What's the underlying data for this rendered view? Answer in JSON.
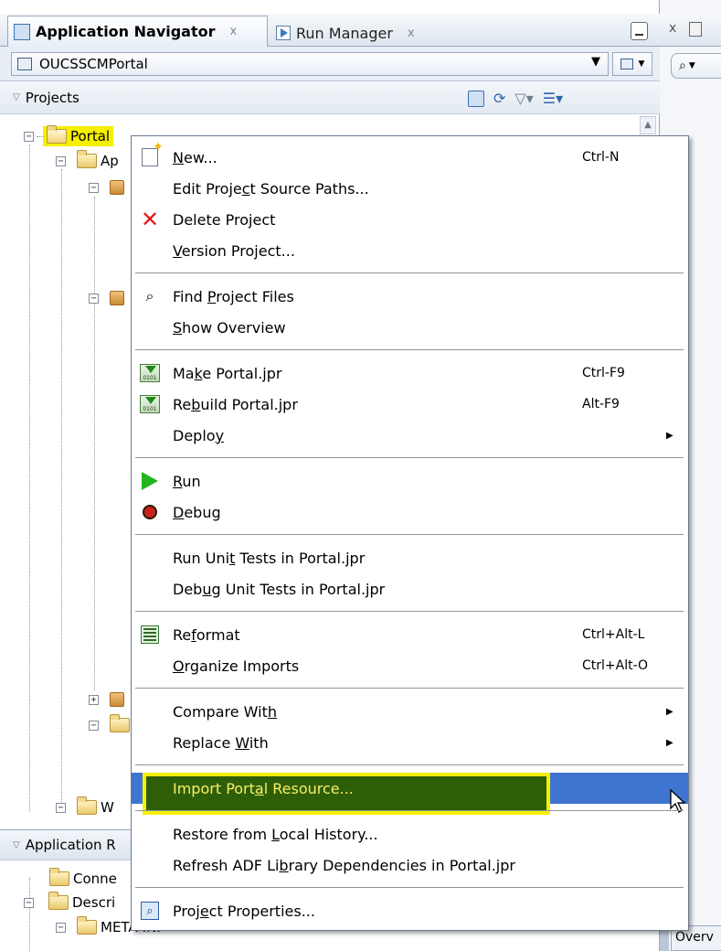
{
  "tabs": {
    "active": "Application Navigator",
    "inactive": "Run Manager",
    "close_glyph": "x"
  },
  "app_selector": {
    "value": "OUCSSCMPortal"
  },
  "projects_header": {
    "label": "Projects"
  },
  "tree": {
    "portal": "Portal",
    "row_ap": "Ap",
    "row_w": "W",
    "connections": "Conne",
    "descriptors": "Descri",
    "meta_inf": "META-INF"
  },
  "app_resources_header": {
    "label": "Application R"
  },
  "right_strip": {
    "close": "x",
    "bottom_tab": "Overv"
  },
  "context_menu": {
    "groups": [
      [
        {
          "icon": "new-icon",
          "pre": "",
          "mn": "N",
          "post": "ew...",
          "shortcut": "Ctrl-N",
          "submenu": false
        },
        {
          "icon": "",
          "pre": "Edit Proje",
          "mn": "c",
          "post": "t Source Paths...",
          "shortcut": "",
          "submenu": false
        },
        {
          "icon": "delete-icon",
          "pre": "Delete Project",
          "mn": "",
          "post": "",
          "shortcut": "",
          "submenu": false
        },
        {
          "icon": "",
          "pre": "",
          "mn": "V",
          "post": "ersion Project...",
          "shortcut": "",
          "submenu": false
        }
      ],
      [
        {
          "icon": "binoculars-icon",
          "pre": "Find ",
          "mn": "P",
          "post": "roject Files",
          "shortcut": "",
          "submenu": false
        },
        {
          "icon": "",
          "pre": "",
          "mn": "S",
          "post": "how Overview",
          "shortcut": "",
          "submenu": false
        }
      ],
      [
        {
          "icon": "make-icon",
          "pre": "Ma",
          "mn": "k",
          "post": "e Portal.jpr",
          "shortcut": "Ctrl-F9",
          "submenu": false
        },
        {
          "icon": "rebuild-icon",
          "pre": "Re",
          "mn": "b",
          "post": "uild Portal.jpr",
          "shortcut": "Alt-F9",
          "submenu": false
        },
        {
          "icon": "",
          "pre": "Deplo",
          "mn": "y",
          "post": "",
          "shortcut": "",
          "submenu": true
        }
      ],
      [
        {
          "icon": "run-icon",
          "pre": "",
          "mn": "R",
          "post": "un",
          "shortcut": "",
          "submenu": false
        },
        {
          "icon": "debug-icon",
          "pre": "",
          "mn": "D",
          "post": "ebug",
          "shortcut": "",
          "submenu": false
        }
      ],
      [
        {
          "icon": "",
          "pre": "Run Uni",
          "mn": "t",
          "post": " Tests in Portal.jpr",
          "shortcut": "",
          "submenu": false
        },
        {
          "icon": "",
          "pre": "Deb",
          "mn": "u",
          "post": "g Unit Tests in Portal.jpr",
          "shortcut": "",
          "submenu": false
        }
      ],
      [
        {
          "icon": "reformat-icon",
          "pre": "Re",
          "mn": "f",
          "post": "ormat",
          "shortcut": "Ctrl+Alt-L",
          "submenu": false
        },
        {
          "icon": "",
          "pre": "",
          "mn": "O",
          "post": "rganize Imports",
          "shortcut": "Ctrl+Alt-O",
          "submenu": false
        }
      ],
      [
        {
          "icon": "",
          "pre": "Compare Wit",
          "mn": "h",
          "post": "",
          "shortcut": "",
          "submenu": true
        },
        {
          "icon": "",
          "pre": "Replace ",
          "mn": "W",
          "post": "ith",
          "shortcut": "",
          "submenu": true
        }
      ],
      [
        {
          "icon": "",
          "pre": "Import Port",
          "mn": "a",
          "post": "l Resource...",
          "shortcut": "",
          "submenu": false,
          "highlighted": true
        }
      ],
      [
        {
          "icon": "",
          "pre": "Restore from ",
          "mn": "L",
          "post": "ocal History...",
          "shortcut": "",
          "submenu": false
        },
        {
          "icon": "",
          "pre": "Refresh ADF Li",
          "mn": "b",
          "post": "rary Dependencies in Portal.jpr",
          "shortcut": "",
          "submenu": false
        }
      ],
      [
        {
          "icon": "properties-icon",
          "pre": "Proj",
          "mn": "e",
          "post": "ct Properties...",
          "shortcut": "",
          "submenu": false
        }
      ]
    ]
  },
  "colors": {
    "selection": "#3f74d1",
    "yellow_highlight": "#f5f000",
    "highlight_fill": "#2f5e08"
  }
}
